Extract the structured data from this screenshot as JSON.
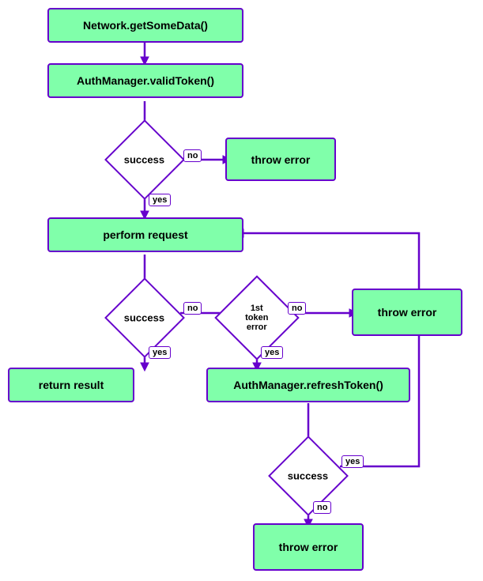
{
  "nodes": {
    "getSomeData": {
      "label": "Network.getSomeData()"
    },
    "validToken": {
      "label": "AuthManager.validToken()"
    },
    "successDiamond1": {
      "label": "success"
    },
    "throwError1": {
      "label": "throw error"
    },
    "performRequest": {
      "label": "perform request"
    },
    "successDiamond2": {
      "label": "success"
    },
    "tokenErrorDiamond": {
      "label": "1st\ntoken\nerror"
    },
    "throwError2": {
      "label": "throw error"
    },
    "returnResult": {
      "label": "return result"
    },
    "refreshToken": {
      "label": "AuthManager.refreshToken()"
    },
    "successDiamond3": {
      "label": "success"
    },
    "throwError3": {
      "label": "throw error"
    }
  },
  "labels": {
    "no": "no",
    "yes": "yes"
  }
}
